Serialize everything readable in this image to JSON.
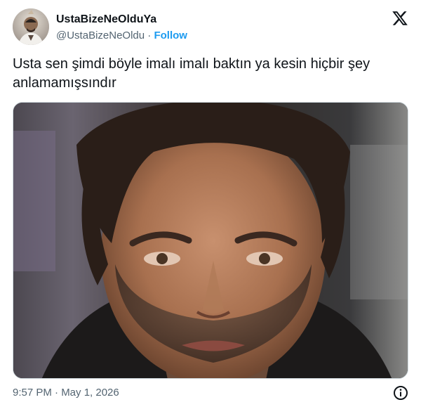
{
  "author": {
    "display_name": "UstaBizeNeOlduYa",
    "handle": "@UstaBizeNeOldu",
    "separator": "·",
    "follow_label": "Follow"
  },
  "tweet": {
    "text": "Usta sen şimdi böyle imalı imalı baktın ya kesin hiçbir şey\nanlamamışsındır"
  },
  "media": {
    "description_icon": "photo-of-man"
  },
  "footer": {
    "timestamp": "9:57 PM · May 1, 2026"
  },
  "icons": {
    "logo": "x-logo-icon",
    "info": "info-icon"
  },
  "colors": {
    "text": "#0f1419",
    "muted": "#536471",
    "accent": "#1d9bf0"
  }
}
